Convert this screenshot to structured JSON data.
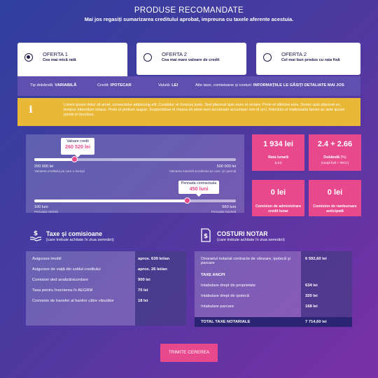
{
  "header": {
    "title": "PRODUSE RECOMANDATE",
    "subtitle": "Mai jos regasiți sumarizarea creditului aprobat, impreuna cu taxele aferente acestuia."
  },
  "offers": [
    {
      "title": "OFERTA 1",
      "subtitle": "Cea mai mică rată",
      "selected": true
    },
    {
      "title": "OFERTA 2",
      "subtitle": "Cea mai mare valoare de credit",
      "selected": false
    },
    {
      "title": "OFERTA 2",
      "subtitle": "Cel mai bun produs cu rata fixă",
      "selected": false
    }
  ],
  "infobar": {
    "rate_type_label": "Tip dobândă:",
    "rate_type_value": "VARIABILĂ",
    "credit_label": "Credit:",
    "credit_value": "IPOTECAR",
    "currency_label": "Valută:",
    "currency_value": "LEI",
    "fees_label": "Alte taxe, comisioane și costuri:",
    "fees_value": "INFORMAȚIILE LE GĂSIȚI DETALIATE MAI JOS"
  },
  "notice": {
    "icon": "info-icon",
    "text": "Lorem ipsum dolor sit amet, consectetur adipiscing elit. Curabitur ut rhoncus justo. Sed placerat quis nunc et ornare. Proin et ultricies eros. Donec quis placerat ex, tempus bibendum neque. Proin id pretium augue. Suspendisse id massa sit amet sem accumsan accumsan non id orci. Interdum et malesuada fames ac ante ipsum primis in faucibus."
  },
  "credit_slider": {
    "label": "Valoare credit",
    "value": "260 520 lei",
    "min_label": "200 000 lei",
    "min_caption": "Valoarea creditului pe care o doreşti",
    "max_label": "500 000 lei",
    "max_caption": "Valoarea maximă acreditului pe care -ţi-l permiţi",
    "fraction": 0.2
  },
  "period_slider": {
    "label": "Perioada contractuala",
    "value": "450 luni",
    "min_label": "100 luni",
    "min_caption": "Perioada minimă",
    "max_label": "560 luni",
    "max_caption": "Perioada maximă",
    "fraction": 0.76
  },
  "cards": [
    {
      "value": "1 934 lei",
      "label": "Rata lunară",
      "sublabel": "(LEI)"
    },
    {
      "value": "2.4 + 2.66",
      "label": "Dobândă",
      "sublabel_small": "(%)",
      "sublabel": "(marjă fixă + IRCC)"
    },
    {
      "value": "0 lei",
      "label": "Comision de administrare credit lunar"
    },
    {
      "value": "0 lei",
      "label": "Comision de rambursare anticipată"
    }
  ],
  "taxes": {
    "icon": "money-hand-icon",
    "title": "Taxe și comisioane",
    "subtitle": "(care trebuie achitate în ziua semnării)",
    "rows": [
      {
        "label": "Asigurare imobil",
        "value": "aprox. 639 lei/an"
      },
      {
        "label": "Asigurare de viață din soldul creditului",
        "value": "aprox. 26 lei/an"
      },
      {
        "label": "Comision ded analiză/acordare",
        "value": "900 lei"
      },
      {
        "label": "Taxa pentru înscrierea în AEGRM",
        "value": "70 lei"
      },
      {
        "label": "Comision de transfer al banilor către vânzător",
        "value": "18 lei"
      }
    ]
  },
  "notary": {
    "icon": "document-dollar-icon",
    "title": "COSTURI NOTAR",
    "subtitle": "(care trebuie achitate în ziua semnării)",
    "rows": [
      {
        "label": "Onorariul notarial contracte de vânzare, ipotecă şi parcare",
        "value": "6 592,60 lei"
      },
      {
        "label": "TAXE ANCPI",
        "value": ""
      },
      {
        "label": "Intabulare drept de proprietate",
        "value": "634 lei"
      },
      {
        "label": "Intabulare drept de ipotecă",
        "value": "320 lei"
      },
      {
        "label": "Intabulare parcare",
        "value": "168 lei"
      }
    ],
    "total_label": "TOTAL TAXE NOTARIALE",
    "total_value": "7 714,60 lei"
  },
  "submit_label": "TRIMITE CEREREA",
  "colors": {
    "accent": "#e8488c",
    "notice": "#e9b836",
    "dark": "#1d1a4a"
  }
}
